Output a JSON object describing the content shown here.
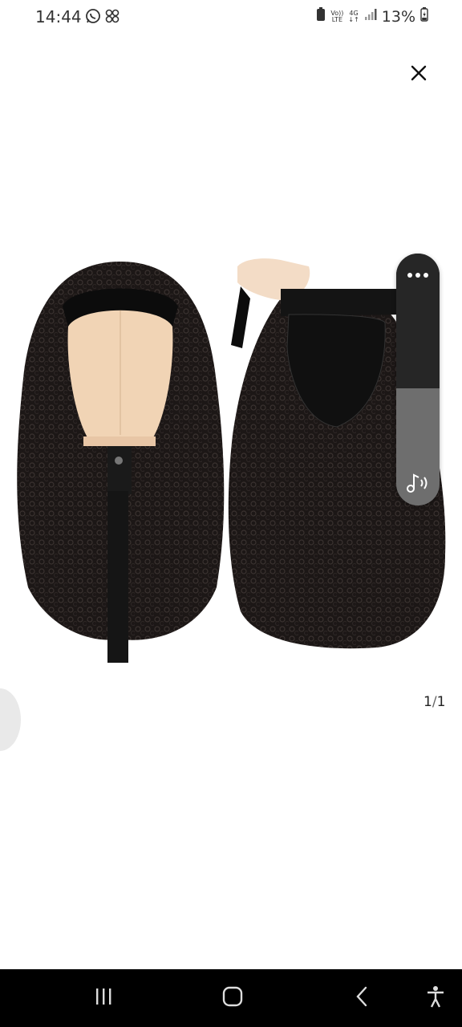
{
  "status_bar": {
    "time": "14:44",
    "battery_percent": "13%",
    "network_label_top": "Vo))",
    "network_label_bottom": "LTE",
    "data_label": "4G",
    "icons": [
      "whatsapp-icon",
      "pinwheel-icon",
      "battery-saver-icon",
      "signal-icon",
      "battery-icon"
    ]
  },
  "viewer": {
    "close_icon": "close-icon",
    "page_current": "1",
    "page_total": "1",
    "more_icon": "more-dots-icon",
    "audio_icon": "music-audio-icon",
    "image_subject": "product-photo-curly-wig"
  },
  "nav_bar": {
    "icons": [
      "recent-apps-icon",
      "home-icon",
      "back-icon",
      "accessibility-icon"
    ]
  },
  "colors": {
    "background": "#ffffff",
    "nav_bar": "#000000",
    "panel_dark": "#262626",
    "panel_light": "#6e6e6e",
    "hair": "#1a1514",
    "mannequin": "#f1d4b5"
  }
}
